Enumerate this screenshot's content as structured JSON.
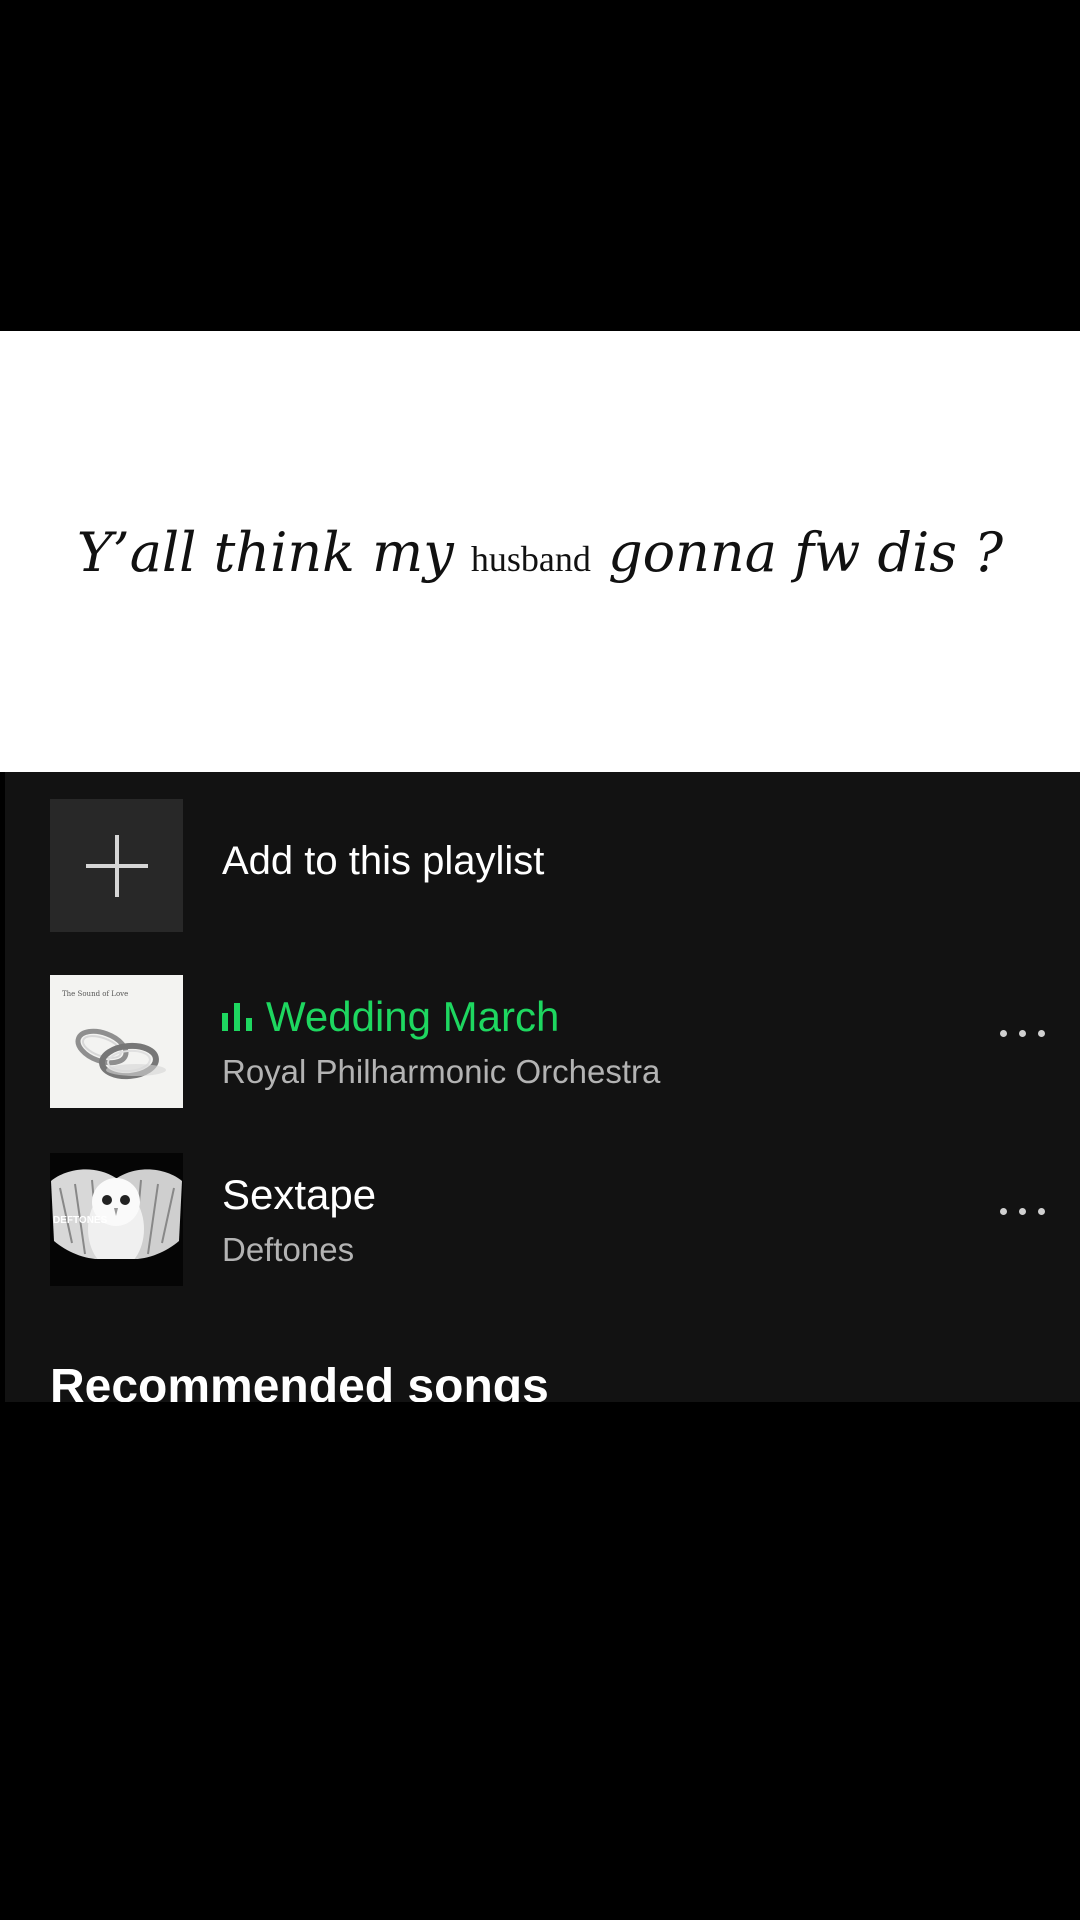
{
  "overlay": {
    "caption_part1": "Y’all think my ",
    "caption_part2": "husband",
    "caption_part3": " gonna fw dis ?"
  },
  "playlist": {
    "add_row": {
      "label": "Add to this playlist",
      "icon": "plus-icon"
    },
    "tracks": [
      {
        "title": "Wedding March",
        "artist": "Royal Philharmonic Orchestra",
        "playing": true,
        "artwork": "wedding-rings-album-art",
        "artwork_label": "The Sound of Love",
        "more_icon": "more-options-icon"
      },
      {
        "title": "Sextape",
        "artist": "Deftones",
        "playing": false,
        "artwork": "white-owl-album-art",
        "artwork_label": "DEFTONES",
        "more_icon": "more-options-icon"
      }
    ],
    "recommended_heading": "Recommended songs"
  },
  "colors": {
    "panel_background": "#121212",
    "playing_green": "#1ed760",
    "secondary_text": "#b3b3b3",
    "caption_background": "#ffffff",
    "letterbox": "#000000"
  }
}
